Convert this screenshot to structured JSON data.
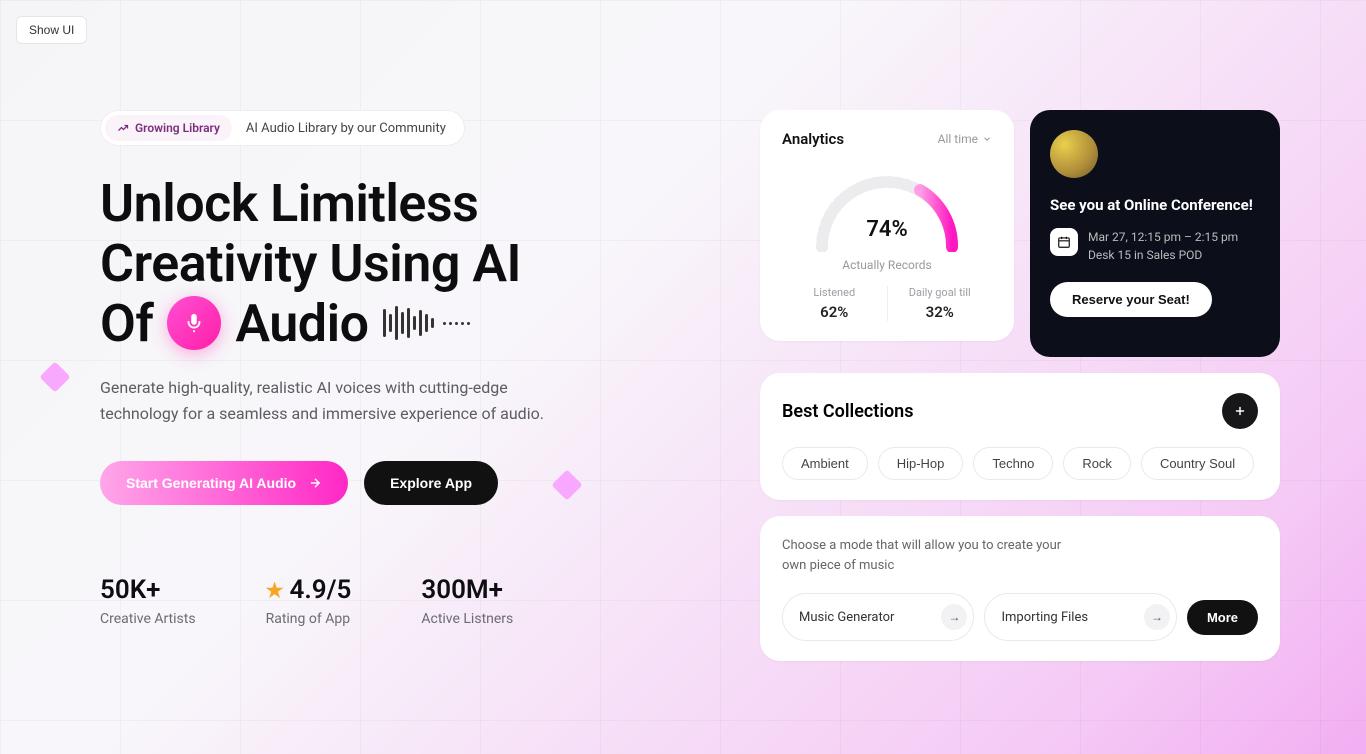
{
  "show_ui": "Show UI",
  "pill": {
    "tag": "Growing Library",
    "text": "AI Audio Library by our Community"
  },
  "headline": {
    "line1": "Unlock Limitless",
    "line2": "Creativity Using AI",
    "line3_pre": "Of",
    "line3_post": "Audio"
  },
  "subtext": "Generate high-quality, realistic AI voices with cutting-edge technology for a seamless and immersive experience of audio.",
  "cta": {
    "primary": "Start Generating AI Audio",
    "secondary": "Explore App"
  },
  "stats": [
    {
      "value": "50K+",
      "label": "Creative Artists"
    },
    {
      "value": "4.9/5",
      "label": "Rating of App",
      "star": true
    },
    {
      "value": "300M+",
      "label": "Active Listners"
    }
  ],
  "analytics": {
    "title": "Analytics",
    "range": "All time",
    "pct": "74%",
    "pct_label": "Actually Records",
    "mini": [
      {
        "label": "Listened",
        "value": "62%"
      },
      {
        "label": "Daily goal till",
        "value": "32%"
      }
    ]
  },
  "conference": {
    "title": "See you at Online Conference!",
    "datetime": "Mar 27, 12:15 pm – 2:15 pm",
    "location": "Desk 15 in Sales POD",
    "cta": "Reserve your Seat!"
  },
  "collections": {
    "title": "Best Collections",
    "tags": [
      "Ambient",
      "Hip-Hop",
      "Techno",
      "Rock",
      "Country Soul"
    ]
  },
  "mode": {
    "desc": "Choose a mode that will allow you to create your own piece of music",
    "chips": [
      "Music Generator",
      "Importing Files"
    ],
    "more": "More"
  }
}
